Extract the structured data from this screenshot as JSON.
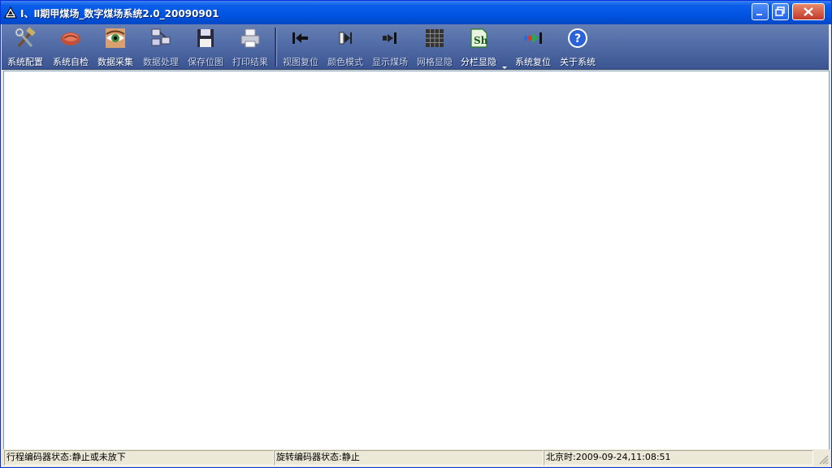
{
  "window": {
    "title": "Ⅰ、Ⅱ期甲煤场_数字煤场系统2.0_20090901",
    "title_bar_color": "#0054e3",
    "toolbar_color": "#4f6aa5"
  },
  "toolbar": {
    "items": [
      {
        "label": "系统配置",
        "icon": "tools-icon",
        "enabled": true
      },
      {
        "label": "系统自检",
        "icon": "self-check-icon",
        "enabled": true
      },
      {
        "label": "数据采集",
        "icon": "eye-icon",
        "enabled": true
      },
      {
        "label": "数据处理",
        "icon": "network-computers-icon",
        "enabled": false
      },
      {
        "label": "保存位图",
        "icon": "floppy-disk-icon",
        "enabled": false
      },
      {
        "label": "打印结果",
        "icon": "printer-icon",
        "enabled": false
      },
      {
        "label": "视图复位",
        "icon": "arrow-left-bar-icon",
        "enabled": false
      },
      {
        "label": "颜色模式",
        "icon": "color-mode-icon",
        "enabled": false
      },
      {
        "label": "显示煤场",
        "icon": "arrow-right-bar-icon",
        "enabled": false
      },
      {
        "label": "网格显隐",
        "icon": "grid-icon",
        "enabled": false
      },
      {
        "label": "分栏显隐",
        "icon": "sheet-columns-icon",
        "enabled": true
      },
      {
        "label": "系统复位",
        "icon": "reset-arrow-icon",
        "enabled": true
      },
      {
        "label": "关于系统",
        "icon": "help-icon",
        "enabled": true
      }
    ]
  },
  "statusbar": {
    "travel_encoder": "行程编码器状态:静止或未放下",
    "rotary_encoder": "旋转编码器状态:静止",
    "clock": "北京时:2009-09-24,11:08:51"
  }
}
